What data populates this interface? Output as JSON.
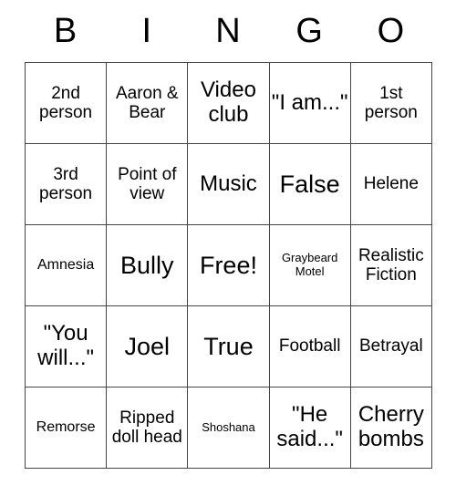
{
  "card": {
    "title_letters": [
      "B",
      "I",
      "N",
      "G",
      "O"
    ],
    "columns": 5,
    "rows": 5,
    "free_space_text": "Free!",
    "border_color": "#444444",
    "background_color": "#ffffff",
    "text_color": "#000000",
    "cells": [
      [
        {
          "text": "2nd person",
          "size": "md"
        },
        {
          "text": "Aaron & Bear",
          "size": "md"
        },
        {
          "text": "Video club",
          "size": "lg"
        },
        {
          "text": "\"I am...\"",
          "size": "lg"
        },
        {
          "text": "1st person",
          "size": "md"
        }
      ],
      [
        {
          "text": "3rd person",
          "size": "md"
        },
        {
          "text": "Point of view",
          "size": "md"
        },
        {
          "text": "Music",
          "size": "lg"
        },
        {
          "text": "False",
          "size": "xl"
        },
        {
          "text": "Helene",
          "size": "md"
        }
      ],
      [
        {
          "text": "Amnesia",
          "size": "sm"
        },
        {
          "text": "Bully",
          "size": "xl"
        },
        {
          "text": "Free!",
          "size": "xl"
        },
        {
          "text": "Graybeard Motel",
          "size": "xs"
        },
        {
          "text": "Realistic Fiction",
          "size": "md"
        }
      ],
      [
        {
          "text": "\"You will...\"",
          "size": "lg"
        },
        {
          "text": "Joel",
          "size": "xl"
        },
        {
          "text": "True",
          "size": "xl"
        },
        {
          "text": "Football",
          "size": "md"
        },
        {
          "text": "Betrayal",
          "size": "md"
        }
      ],
      [
        {
          "text": "Remorse",
          "size": "sm"
        },
        {
          "text": "Ripped doll head",
          "size": "md"
        },
        {
          "text": "Shoshana",
          "size": "xs"
        },
        {
          "text": "\"He said...\"",
          "size": "lg"
        },
        {
          "text": "Cherry bombs",
          "size": "lg"
        }
      ]
    ]
  }
}
